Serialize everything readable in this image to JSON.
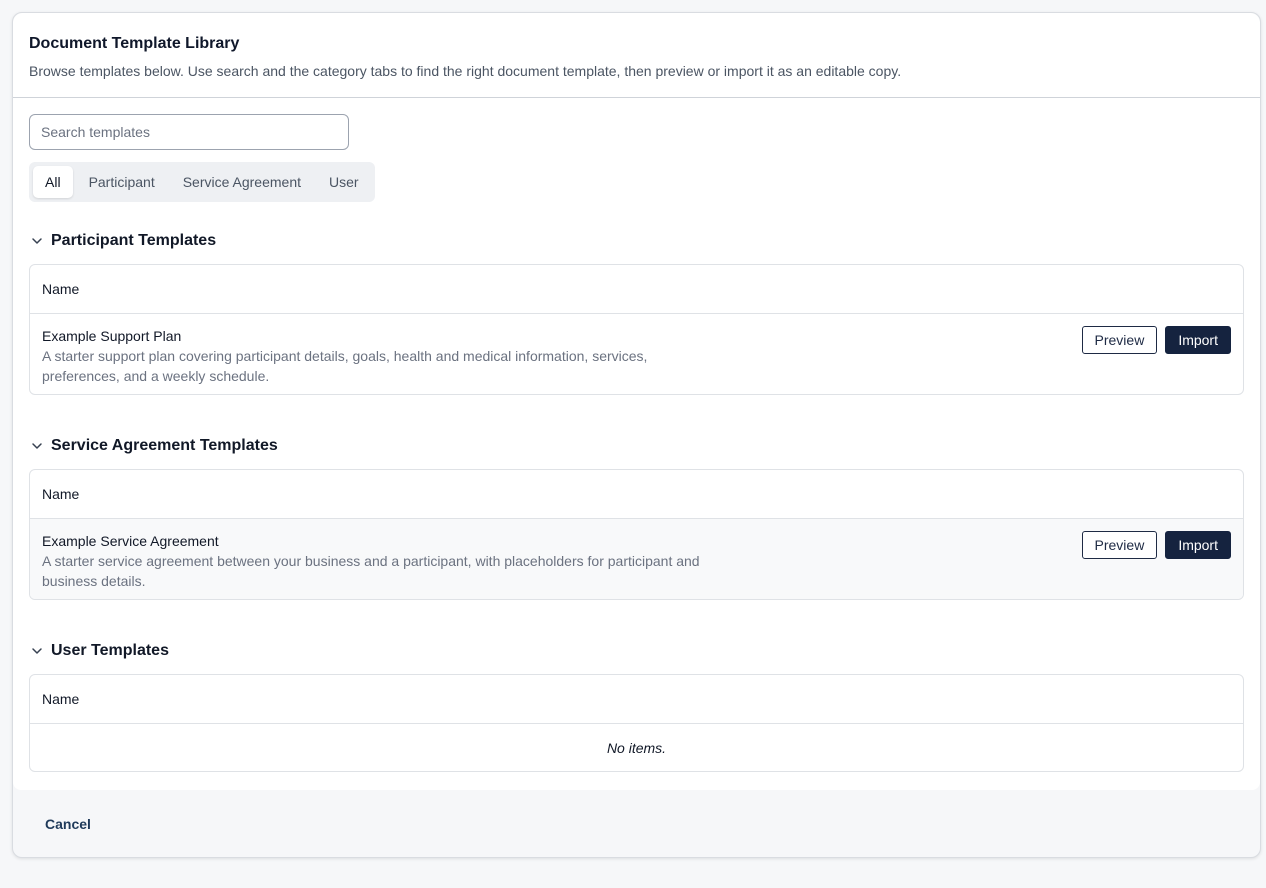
{
  "dialog": {
    "title": "Document Template Library",
    "description": "Browse templates below. Use search and the category tabs to find the right document template, then preview or import it as an editable copy."
  },
  "search": {
    "placeholder": "Search templates",
    "value": ""
  },
  "tabs": [
    {
      "label": "All",
      "active": true
    },
    {
      "label": "Participant",
      "active": false
    },
    {
      "label": "Service Agreement",
      "active": false
    },
    {
      "label": "User",
      "active": false
    }
  ],
  "sections": {
    "participant": {
      "title": "Participant Templates",
      "column_header": "Name",
      "rows": [
        {
          "name": "Example Support Plan",
          "description": "A starter support plan covering participant details, goals, health and medical information, services, preferences, and a weekly schedule.",
          "preview_label": "Preview",
          "import_label": "Import"
        }
      ]
    },
    "service_agreement": {
      "title": "Service Agreement Templates",
      "column_header": "Name",
      "rows": [
        {
          "name": "Example Service Agreement",
          "description": "A starter service agreement between your business and a participant, with placeholders for participant and business details.",
          "preview_label": "Preview",
          "import_label": "Import"
        }
      ]
    },
    "user": {
      "title": "User Templates",
      "column_header": "Name",
      "empty_text": "No items."
    }
  },
  "footer": {
    "cancel_label": "Cancel"
  },
  "icons": {
    "section_toggle": "chevron-down-icon"
  },
  "colors": {
    "primary": "#15233f",
    "link": "#1f3a5a",
    "border": "#dfe2e6"
  }
}
